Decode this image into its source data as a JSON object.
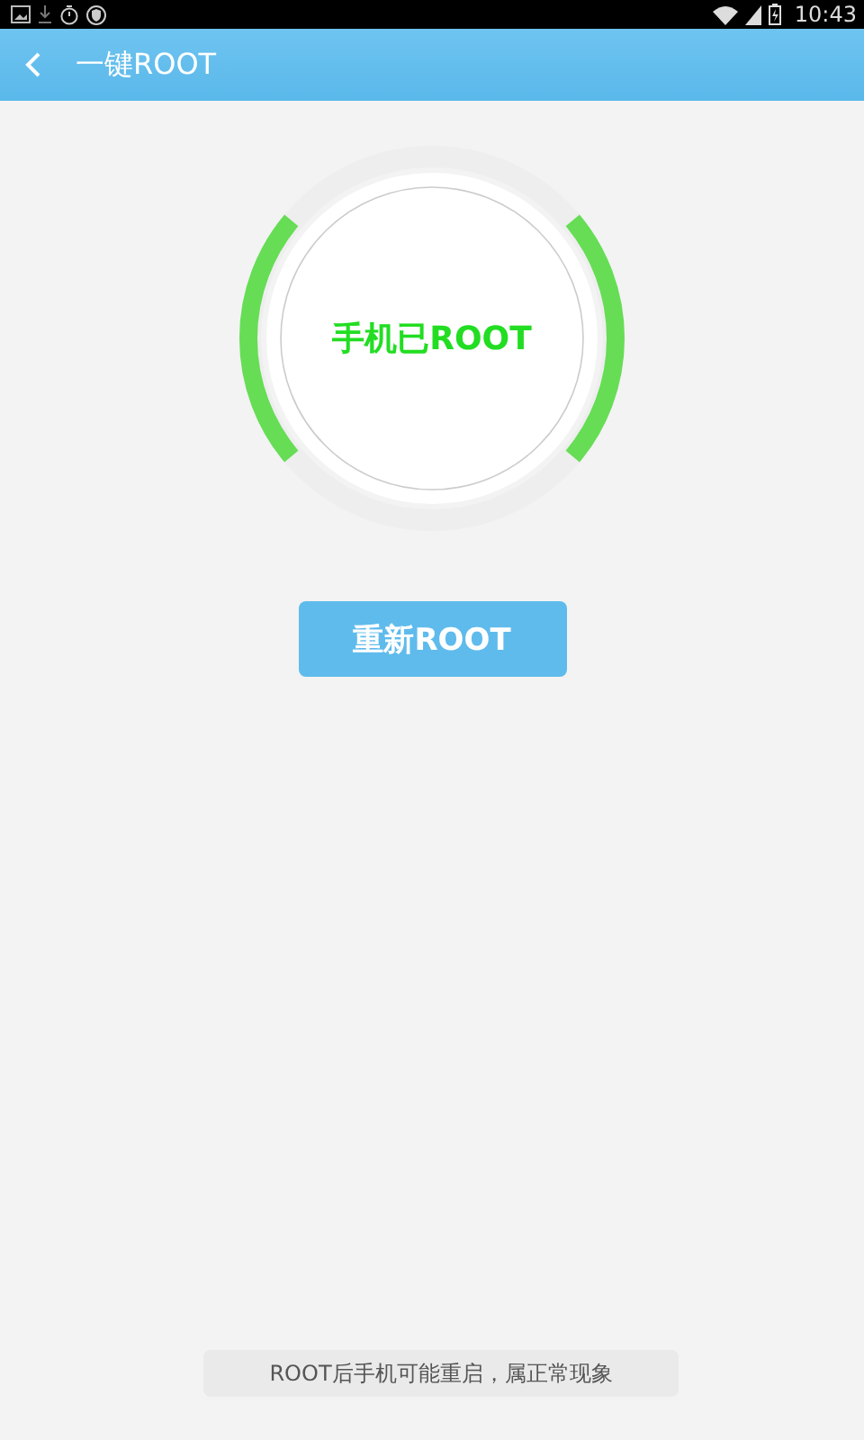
{
  "status_bar": {
    "time": "10:43"
  },
  "header": {
    "title": "一键ROOT"
  },
  "status": {
    "text": "手机已ROOT"
  },
  "action_button": {
    "label": "重新ROOT"
  },
  "note": {
    "text": "ROOT后手机可能重启，属正常现象"
  }
}
